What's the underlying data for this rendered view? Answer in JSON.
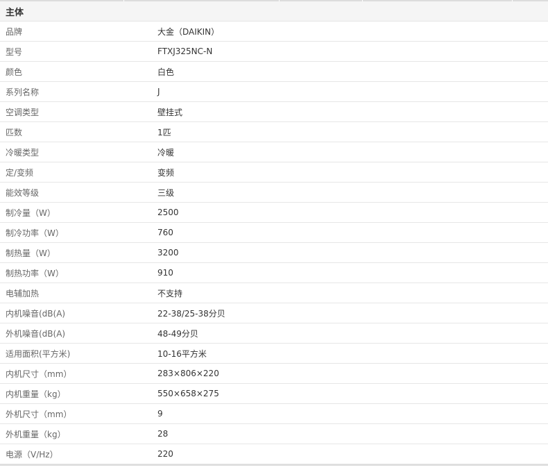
{
  "section": {
    "title": "主体"
  },
  "specs": [
    {
      "label": "品牌",
      "value": "大金（DAIKIN）"
    },
    {
      "label": "型号",
      "value": "FTXJ325NC-N"
    },
    {
      "label": "颜色",
      "value": "白色"
    },
    {
      "label": "系列名称",
      "value": "J"
    },
    {
      "label": "空调类型",
      "value": "壁挂式"
    },
    {
      "label": "匹数",
      "value": "1匹"
    },
    {
      "label": "冷暖类型",
      "value": "冷暖"
    },
    {
      "label": "定/变频",
      "value": "变频"
    },
    {
      "label": "能效等级",
      "value": "三级"
    },
    {
      "label": "制冷量（W）",
      "value": "2500"
    },
    {
      "label": "制冷功率（W）",
      "value": "760"
    },
    {
      "label": "制热量（W）",
      "value": "3200"
    },
    {
      "label": "制热功率（W）",
      "value": "910"
    },
    {
      "label": "电辅加热",
      "value": "不支持"
    },
    {
      "label": "内机噪音(dB(A)",
      "value": "22-38/25-38分贝"
    },
    {
      "label": "外机噪音(dB(A)",
      "value": "48-49分贝"
    },
    {
      "label": "适用面积(平方米)",
      "value": "10-16平方米"
    },
    {
      "label": "内机尺寸（mm）",
      "value": "283×806×220"
    },
    {
      "label": "内机重量（kg）",
      "value": "550×658×275"
    },
    {
      "label": "外机尺寸（mm）",
      "value": "9"
    },
    {
      "label": "外机重量（kg）",
      "value": "28"
    },
    {
      "label": "电源（V/Hz）",
      "value": "220"
    }
  ]
}
